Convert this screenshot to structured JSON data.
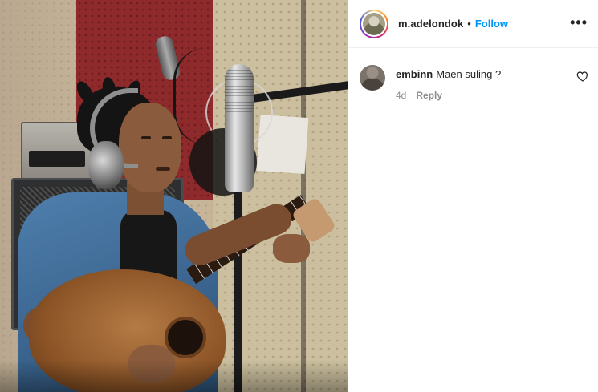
{
  "post": {
    "username": "m.adelondok",
    "separator": "•",
    "follow_label": "Follow",
    "more_label": "•••"
  },
  "comments": [
    {
      "user": "embinn",
      "text": "Maen suling ?",
      "age": "4d",
      "reply_label": "Reply"
    }
  ],
  "colors": {
    "follow_blue": "#0095f6",
    "text_primary": "#262626",
    "text_secondary": "#8e8e8e",
    "divider": "#efefef"
  },
  "icons": [
    "more-options-icon",
    "heart-icon"
  ]
}
